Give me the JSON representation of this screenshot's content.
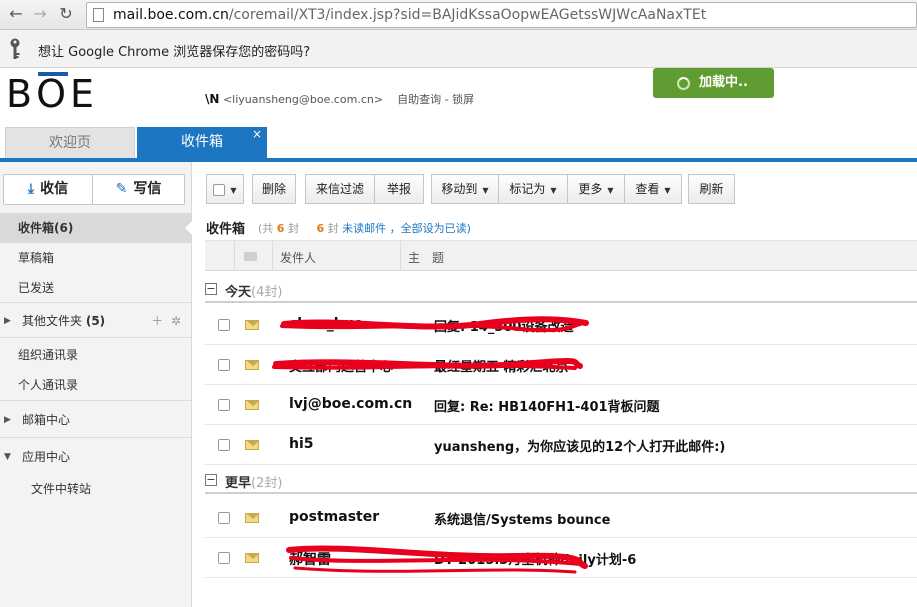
{
  "browser": {
    "url_host": "mail.boe.com.cn",
    "url_path": "/coremail/XT3/index.jsp?sid=BAJidKssaOopwEAGetssWJWcAaNaxTEt",
    "password_prompt": "想让 Google Chrome 浏览器保存您的密码吗?",
    "icons": [
      "back-icon",
      "forward-icon",
      "reload-icon",
      "page-icon",
      "key-icon"
    ]
  },
  "header": {
    "logo": "BOE",
    "user_n": "\\N",
    "user_email": "<liyuansheng@boe.com.cn>",
    "self_query": "自助查询",
    "separator": "-",
    "lock": "锁屏",
    "loading": "加载中.."
  },
  "tabs": [
    {
      "label": "欢迎页"
    },
    {
      "label": "收件箱",
      "close": "×"
    }
  ],
  "sidebar": {
    "receive": "收信",
    "write": "写信",
    "items": [
      {
        "label": "收件箱(6)"
      },
      {
        "label": "草稿箱"
      },
      {
        "label": "已发送"
      },
      {
        "label": "其他文件夹",
        "count": "(5)"
      },
      {
        "label": "组织通讯录"
      },
      {
        "label": "个人通讯录"
      },
      {
        "label": "邮箱中心"
      },
      {
        "label": "应用中心"
      },
      {
        "label": "文件中转站"
      }
    ]
  },
  "toolbar": {
    "delete": "删除",
    "filter": "来信过滤",
    "report": "举报",
    "move_to": "移动到",
    "mark_as": "标记为",
    "more": "更多",
    "view": "查看",
    "refresh": "刷新"
  },
  "inbox": {
    "title": "收件箱",
    "total_prefix": "(共",
    "total": "6",
    "total_unit": "封",
    "unread": "6",
    "unread_unit": "封",
    "unread_label": "未读邮件",
    "mark_all": "，全部设为已读)",
    "col_sender": "发件人",
    "col_subject": "主　题"
  },
  "groups": [
    {
      "label": "今天",
      "count": "(4封)",
      "toggle": "−"
    },
    {
      "label": "更早",
      "count": "(2封)",
      "toggle": "−"
    }
  ],
  "mails": [
    {
      "sender": "chen_huo",
      "subject": "回复: 14_300设备改造"
    },
    {
      "sender": "交互部门运营中心",
      "subject": "最红星期五 精彩汇北京"
    },
    {
      "sender": "lvj@boe.com.cn",
      "subject": "回复: Re: HB140FH1-401背板问题"
    },
    {
      "sender": "hi5",
      "subject": "yuansheng，为你应该见的12个人打开此邮件:)"
    },
    {
      "sender": "postmaster",
      "subject": "系统退信/Systems bounce"
    },
    {
      "sender": "郝智雷",
      "subject": "DT 2015.3月全机种daily计划-6"
    }
  ],
  "colors": {
    "accent_blue": "#1d76c2",
    "loading_green": "#5f9d32",
    "count_orange": "#e07b1a",
    "redaction_red": "#e8001c"
  }
}
